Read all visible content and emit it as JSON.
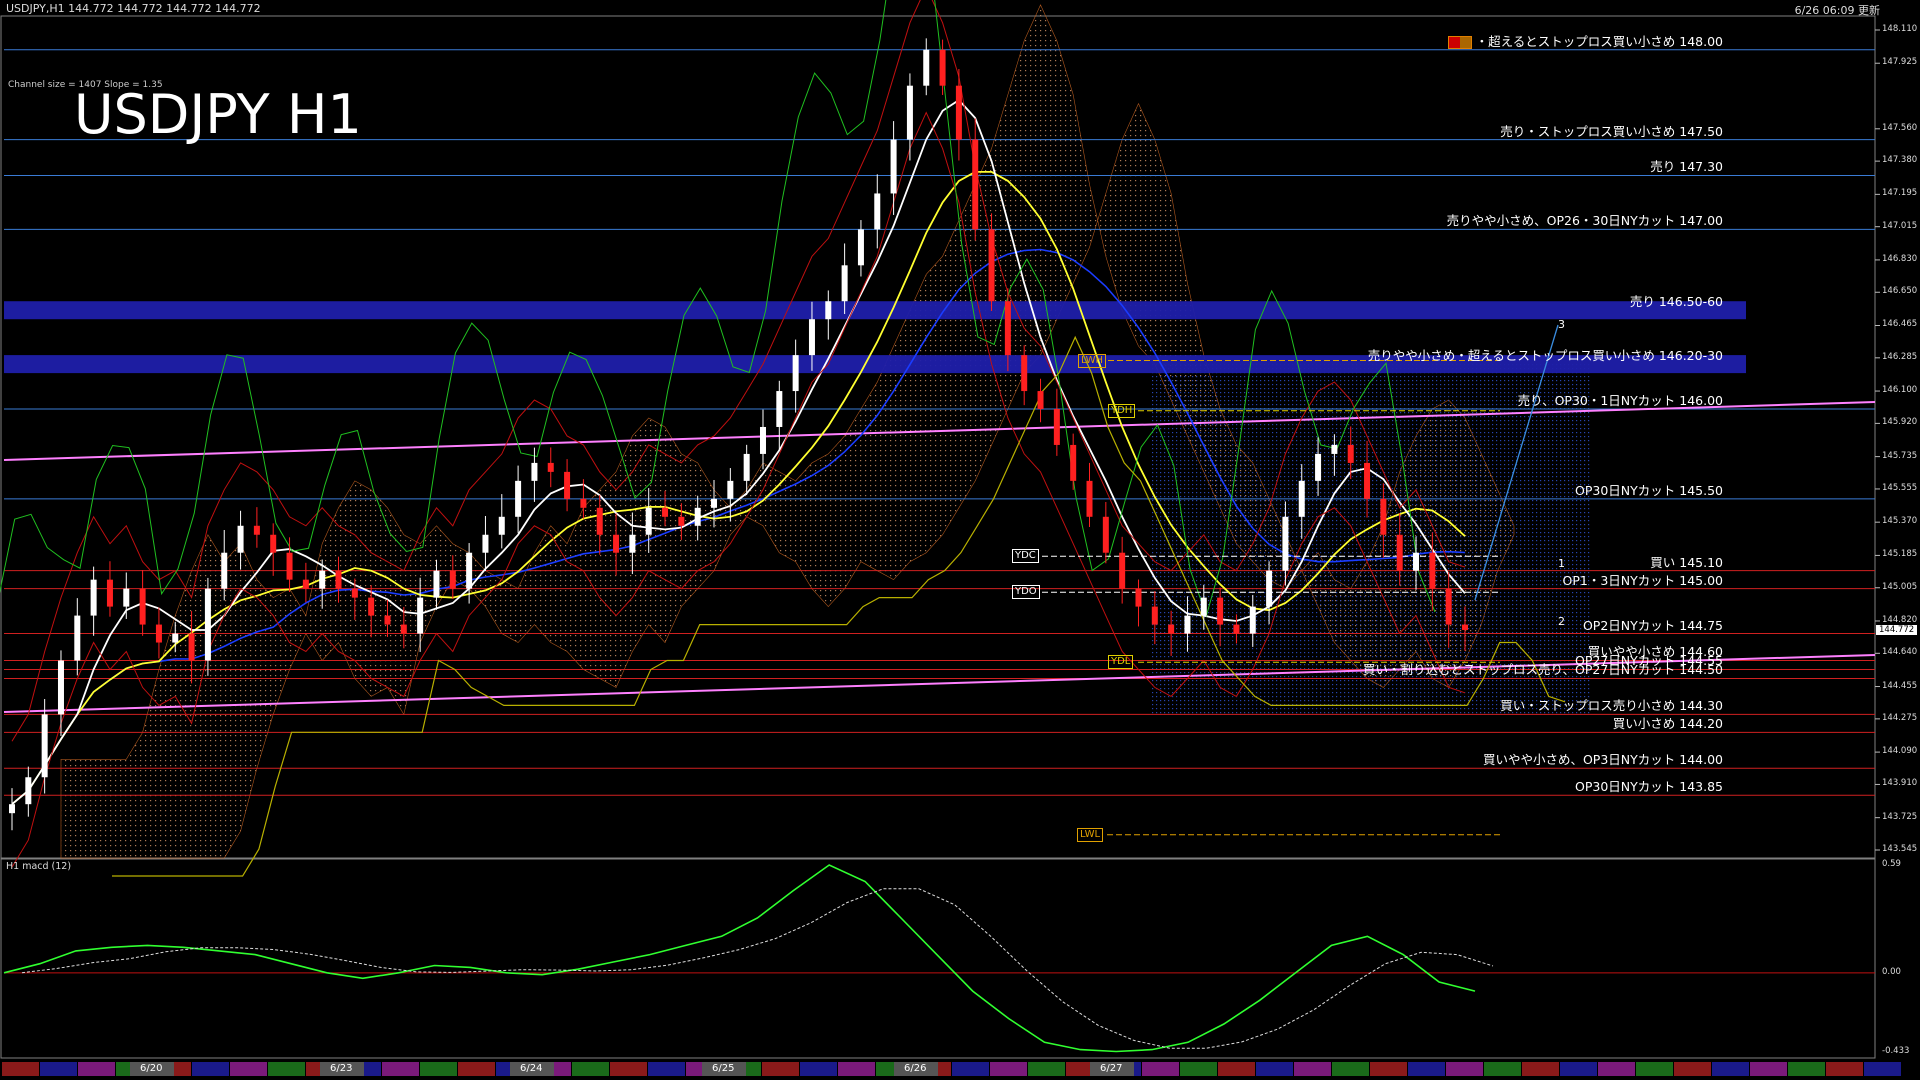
{
  "header": {
    "symbol_info": "USDJPY,H1  144.772 144.772 144.772 144.772",
    "time_info": "6/26 06:09 更新"
  },
  "title": "USDJPY H1",
  "channel_info": "Channel size = 1407 Slope = 1.35",
  "colors": {
    "bg": "#000000",
    "candle_up": "#ffffff",
    "candle_down": "#ff2020",
    "sell_line": "#3a7bd5",
    "buy_line": "#d02020",
    "band": "#1f1faa",
    "ma_white": "#ffffff",
    "ma_yellow": "#ffff30",
    "ma_blue": "#1a3cff",
    "trend_pink": "#ff80ff",
    "macd_green": "#30ff30",
    "macd_pink": "#ff80c0"
  },
  "price_axis": {
    "ticks": [
      "148.110",
      "147.925",
      "147.560",
      "147.380",
      "147.195",
      "147.015",
      "146.830",
      "146.650",
      "146.465",
      "146.285",
      "146.100",
      "145.920",
      "145.735",
      "145.555",
      "145.370",
      "145.185",
      "145.005",
      "144.820",
      "144.640",
      "144.455",
      "144.275",
      "144.090",
      "143.910",
      "143.725",
      "143.545"
    ],
    "current_price": "144.772"
  },
  "annotations": [
    {
      "text": "・超えるとストップロス買い小さめ 148.00",
      "price": 148.0,
      "type": "sell",
      "mw": true
    },
    {
      "text": "売り・ストップロス買い小さめ 147.50",
      "price": 147.5,
      "type": "sell"
    },
    {
      "text": "売り 147.30",
      "price": 147.3,
      "type": "sell"
    },
    {
      "text": "売りやや小さめ、OP26・30日NYカット 147.00",
      "price": 147.0,
      "type": "sell"
    },
    {
      "text": "売り 146.50-60",
      "price": 146.55,
      "type": "band"
    },
    {
      "text": "売りやや小さめ・超えるとストップロス買い小さめ 146.20-30",
      "price": 146.25,
      "type": "band"
    },
    {
      "text": "売り、OP30・1日NYカット 146.00",
      "price": 146.0,
      "type": "sell"
    },
    {
      "text": "OP30日NYカット 145.50",
      "price": 145.5,
      "type": "sell"
    },
    {
      "text": "買い 145.10",
      "price": 145.1,
      "type": "buy"
    },
    {
      "text": "OP1・3日NYカット 145.00",
      "price": 145.0,
      "type": "buy"
    },
    {
      "text": "OP2日NYカット 144.75",
      "price": 144.75,
      "type": "buy"
    },
    {
      "text": "買いやや小さめ 144.60",
      "price": 144.6,
      "type": "buy"
    },
    {
      "text": "OP27日NYカット 144.55",
      "price": 144.55,
      "type": "buy"
    },
    {
      "text": "買い・割り込むとストップロス売り、OP27日NYカット 144.50",
      "price": 144.5,
      "type": "buy"
    },
    {
      "text": "買い・ストップロス売り小さめ 144.30",
      "price": 144.3,
      "type": "buy"
    },
    {
      "text": "買い小さめ 144.20",
      "price": 144.2,
      "type": "buy"
    },
    {
      "text": "買いやや小さめ、OP3日NYカット 144.00",
      "price": 144.0,
      "type": "buy"
    },
    {
      "text": "OP30日NYカット 143.85",
      "price": 143.85,
      "type": "buy"
    }
  ],
  "level_labels": [
    {
      "text": "LWH",
      "price": 146.27,
      "color": "#e0a000"
    },
    {
      "text": "YDH",
      "price": 145.99,
      "color": "#e0d000"
    },
    {
      "text": "YDC",
      "price": 145.18,
      "color": "#ffffff"
    },
    {
      "text": "YDO",
      "price": 144.98,
      "color": "#ffffff"
    },
    {
      "text": "YDL",
      "price": 144.59,
      "color": "#e0d000"
    },
    {
      "text": "LWL",
      "price": 143.63,
      "color": "#e0a000"
    }
  ],
  "wave_labels": [
    "3",
    "1",
    "2"
  ],
  "macd": {
    "label": "H1  macd (12)",
    "ticks": [
      "0.59",
      "0.00",
      "-0.433"
    ]
  },
  "date_labels": [
    "6/20",
    "6/23",
    "6/24",
    "6/25",
    "6/26",
    "6/27"
  ],
  "chart_data": {
    "type": "candlestick",
    "title": "USDJPY H1",
    "x": [
      "6/20",
      "6/23",
      "6/24",
      "6/25",
      "6/26",
      "6/27"
    ],
    "ylim": [
      143.545,
      148.11
    ],
    "close_path": [
      143.8,
      143.95,
      144.3,
      144.6,
      144.85,
      145.05,
      144.9,
      145.0,
      144.8,
      144.7,
      144.75,
      144.6,
      145.0,
      145.2,
      145.35,
      145.3,
      145.2,
      145.05,
      145.0,
      145.1,
      145.0,
      144.95,
      144.85,
      144.8,
      144.75,
      144.95,
      145.1,
      145.0,
      145.2,
      145.3,
      145.4,
      145.6,
      145.7,
      145.65,
      145.5,
      145.45,
      145.3,
      145.2,
      145.3,
      145.45,
      145.4,
      145.35,
      145.45,
      145.5,
      145.6,
      145.75,
      145.9,
      146.1,
      146.3,
      146.5,
      146.6,
      146.8,
      147.0,
      147.2,
      147.5,
      147.8,
      148.0,
      147.8,
      147.5,
      147.0,
      146.6,
      146.3,
      146.1,
      146.0,
      145.8,
      145.6,
      145.4,
      145.2,
      145.0,
      144.9,
      144.8,
      144.75,
      144.85,
      144.95,
      144.8,
      144.75,
      144.9,
      145.1,
      145.4,
      145.6,
      145.75,
      145.8,
      145.7,
      145.5,
      145.3,
      145.1,
      145.2,
      145.0,
      144.8,
      144.77
    ],
    "macd_path": [
      0.0,
      0.05,
      0.12,
      0.14,
      0.15,
      0.14,
      0.12,
      0.1,
      0.05,
      0.0,
      -0.03,
      0.0,
      0.04,
      0.03,
      0.0,
      -0.01,
      0.02,
      0.06,
      0.1,
      0.15,
      0.2,
      0.3,
      0.45,
      0.59,
      0.5,
      0.3,
      0.1,
      -0.1,
      -0.25,
      -0.38,
      -0.42,
      -0.43,
      -0.42,
      -0.38,
      -0.28,
      -0.15,
      0.0,
      0.15,
      0.2,
      0.1,
      -0.05,
      -0.1
    ]
  }
}
